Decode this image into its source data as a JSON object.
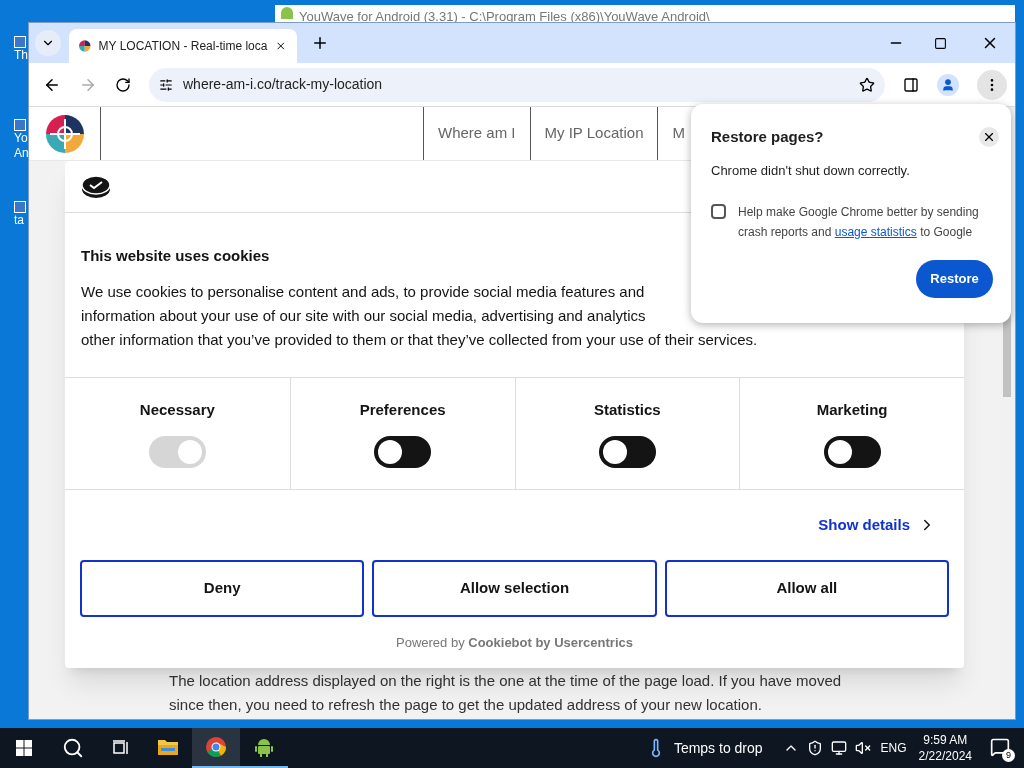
{
  "desktop": {
    "icons": [
      {
        "label": "Th"
      },
      {
        "label": "Yo An"
      },
      {
        "label": "ta"
      }
    ]
  },
  "background_window": {
    "title": "YouWave for Android (3.31) - C:\\Program Files (x86)\\YouWave Android\\"
  },
  "browser": {
    "tabs": [
      {
        "title": "MY LOCATION - Real-time loca",
        "selected": true
      }
    ],
    "address": "where-am-i.co/track-my-location",
    "site": {
      "nav": [
        "Where am I",
        "My IP Location",
        "M"
      ],
      "body_lines": [
        "The location address displayed on the right is the one at the time of the page load. If you have moved",
        "since then, you need to refresh the page to get the updated address of your new location."
      ]
    },
    "cookie_dialog": {
      "title": "This website uses cookies",
      "paragraph_lines": [
        "We use cookies to personalise content and ads, to provide social media features and",
        "information about your use of our site with our social media, advertising and analytics",
        "other information that you’ve provided to them or that they’ve collected from your use of their services."
      ],
      "categories": [
        {
          "label": "Necessary",
          "on": true,
          "disabled": true
        },
        {
          "label": "Preferences",
          "on": false,
          "disabled": false
        },
        {
          "label": "Statistics",
          "on": false,
          "disabled": false
        },
        {
          "label": "Marketing",
          "on": false,
          "disabled": false
        }
      ],
      "show_details": "Show details",
      "buttons": [
        "Deny",
        "Allow selection",
        "Allow all"
      ],
      "powered_by": "Powered by **Cookiebot by Usercentrics**"
    },
    "restore_popup": {
      "title": "Restore pages?",
      "message": "Chrome didn't shut down correctly.",
      "checkbox": {
        "text_before": "Help make Google Chrome better by sending crash reports and",
        "link": "usage statistics",
        "text_after": "to Google",
        "checked": false
      },
      "button": "Restore"
    }
  },
  "taskbar": {
    "apps": [
      {
        "kind": "explorer",
        "running": false,
        "selected": false
      },
      {
        "kind": "chrome",
        "running": true,
        "selected": true
      },
      {
        "kind": "android",
        "running": true,
        "selected": false
      }
    ],
    "weather": "Temps to drop",
    "language": "ENG",
    "time": "9:59 AM",
    "date": "2/22/2024",
    "notifications": "9"
  }
}
